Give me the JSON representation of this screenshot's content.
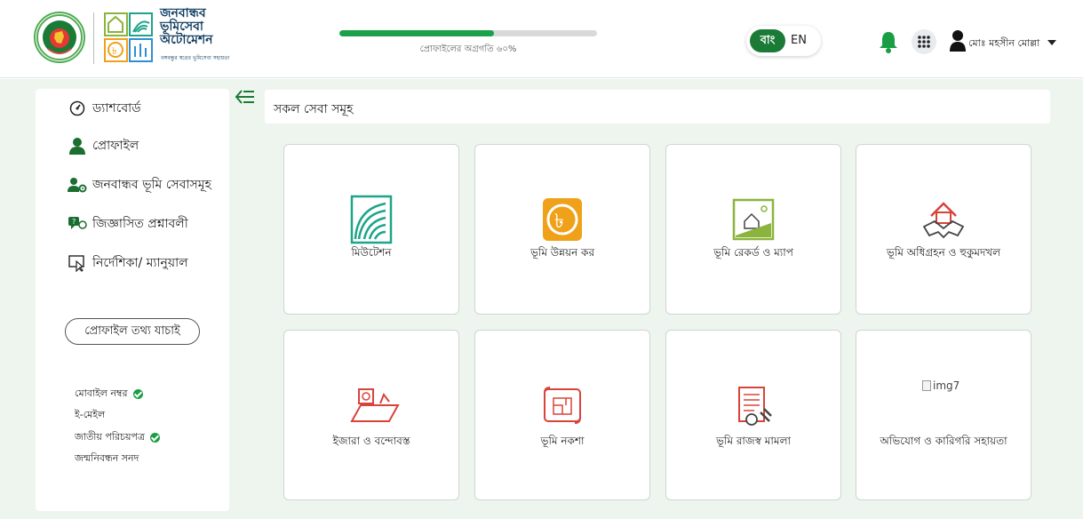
{
  "header": {
    "brand_lines": [
      "জনবান্ধব",
      "ভূমিসেবা",
      "অটোমেশন"
    ],
    "brand_sub": "বঙ্গবন্ধুর স্বপ্নের ভূমিসেবা সহায়তা",
    "progress_label": "প্রোফাইলের অগ্রগতি ৬০%",
    "progress_fraction": 0.6,
    "lang_bn": "বাং",
    "lang_en": "EN",
    "user_name": "মোঃ মহসীন মোল্লা"
  },
  "sidebar": {
    "items": [
      {
        "label": "ড্যাশবোর্ড",
        "icon": "gauge-icon"
      },
      {
        "label": "প্রোফাইল",
        "icon": "user-icon"
      },
      {
        "label": "জনবান্ধব ভূমি সেবাসমূহ",
        "icon": "users-cog-icon"
      },
      {
        "label": "জিজ্ঞাসিত প্রশ্নাবলী",
        "icon": "faq-icon"
      },
      {
        "label": "নির্দেশিকা/ ম্যানুয়াল",
        "icon": "pointer-screen-icon"
      }
    ],
    "verify_button": "প্রোফাইল তথ্য যাচাই",
    "checks": [
      {
        "label": "মোবাইল নম্বর",
        "verified": true
      },
      {
        "label": "ই-মেইল",
        "verified": false
      },
      {
        "label": "জাতীয় পরিচয়পত্র",
        "verified": true
      },
      {
        "label": "জন্মনিবন্ধন সনদ",
        "verified": false
      }
    ]
  },
  "main": {
    "title": "সকল সেবা সমূহ",
    "cards": [
      {
        "label": "মিউটেশন",
        "icon": "fingerprint-icon"
      },
      {
        "label": "ভূমি উন্নয়ন কর",
        "icon": "taka-coin-icon"
      },
      {
        "label": "ভূমি রেকর্ড ও ম্যাপ",
        "icon": "land-map-icon"
      },
      {
        "label": "ভূমি অধিগ্রহন ও হুকুমদখল",
        "icon": "handshake-house-icon"
      },
      {
        "label": "ইজারা ও বন্দোবস্ত",
        "icon": "lease-document-icon"
      },
      {
        "label": "ভূমি নকশা",
        "icon": "blueprint-scroll-icon"
      },
      {
        "label": "ভূমি রাজস্ব মামলা",
        "icon": "revenue-case-icon"
      },
      {
        "label": "অভিযোগ ও কারিগরি সহায়তা",
        "broken_alt": "img7"
      }
    ]
  },
  "colors": {
    "brand_green": "#1a7a36",
    "progress_green": "#1aa14a",
    "bg_mint": "#eef5ee",
    "icon_teal": "#1ea48a",
    "icon_orange": "#f0a11a",
    "icon_olive": "#8ab43c",
    "icon_red": "#d9433a"
  }
}
